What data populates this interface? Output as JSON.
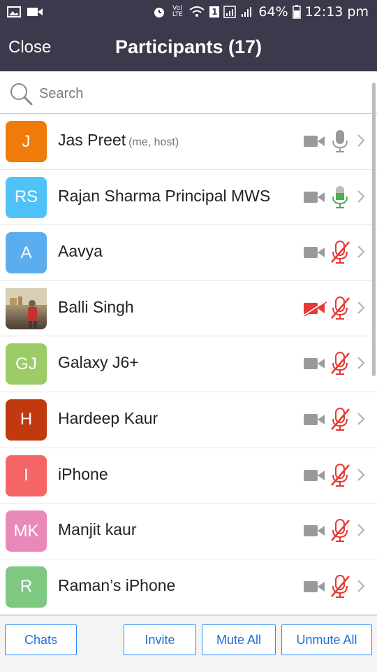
{
  "status_bar": {
    "battery_percent": "64%",
    "time": "12:13 pm",
    "volte_label": "Vo) LTE",
    "sim_label": "1",
    "icons": [
      "image-icon",
      "video-icon",
      "alarm-icon",
      "volte-icon",
      "wifi-icon",
      "sim-icon",
      "signal-icon",
      "battery-icon"
    ]
  },
  "header": {
    "close_label": "Close",
    "title": "Participants (17)"
  },
  "search": {
    "placeholder": "Search"
  },
  "colors": {
    "header_bg": "#3a3a4c",
    "accent_blue": "#2d8cff",
    "mic_active_green": "#4caf50",
    "muted_red": "#e53935",
    "icon_grey": "#9a9a9a"
  },
  "participants": [
    {
      "initials": "J",
      "name": "Jas Preet",
      "suffix": "(me, host)",
      "avatar_color": "#f07a0a",
      "video": "off",
      "mic": "unmuted"
    },
    {
      "initials": "RS",
      "name": "Rajan Sharma Principal MWS",
      "suffix": "",
      "avatar_color": "#4fc3f7",
      "video": "off",
      "mic": "active"
    },
    {
      "initials": "A",
      "name": "Aavya",
      "suffix": "",
      "avatar_color": "#5aaef0",
      "video": "off",
      "mic": "muted"
    },
    {
      "initials": "",
      "name": "Balli Singh",
      "suffix": "",
      "avatar_color": "#8d7b66",
      "video": "blocked",
      "mic": "muted",
      "photo": true
    },
    {
      "initials": "GJ",
      "name": "Galaxy J6+",
      "suffix": "",
      "avatar_color": "#9ccc65",
      "video": "off",
      "mic": "muted"
    },
    {
      "initials": "H",
      "name": "Hardeep Kaur",
      "suffix": "",
      "avatar_color": "#c0390f",
      "video": "off",
      "mic": "muted"
    },
    {
      "initials": "I",
      "name": "iPhone",
      "suffix": "",
      "avatar_color": "#f56565",
      "video": "off",
      "mic": "muted"
    },
    {
      "initials": "MK",
      "name": "Manjit kaur",
      "suffix": "",
      "avatar_color": "#e889b9",
      "video": "off",
      "mic": "muted"
    },
    {
      "initials": "R",
      "name": "Raman’s iPhone",
      "suffix": "",
      "avatar_color": "#7fc882",
      "video": "off",
      "mic": "muted"
    }
  ],
  "footer": {
    "chats_label": "Chats",
    "invite_label": "Invite",
    "mute_all_label": "Mute All",
    "unmute_all_label": "Unmute All"
  }
}
